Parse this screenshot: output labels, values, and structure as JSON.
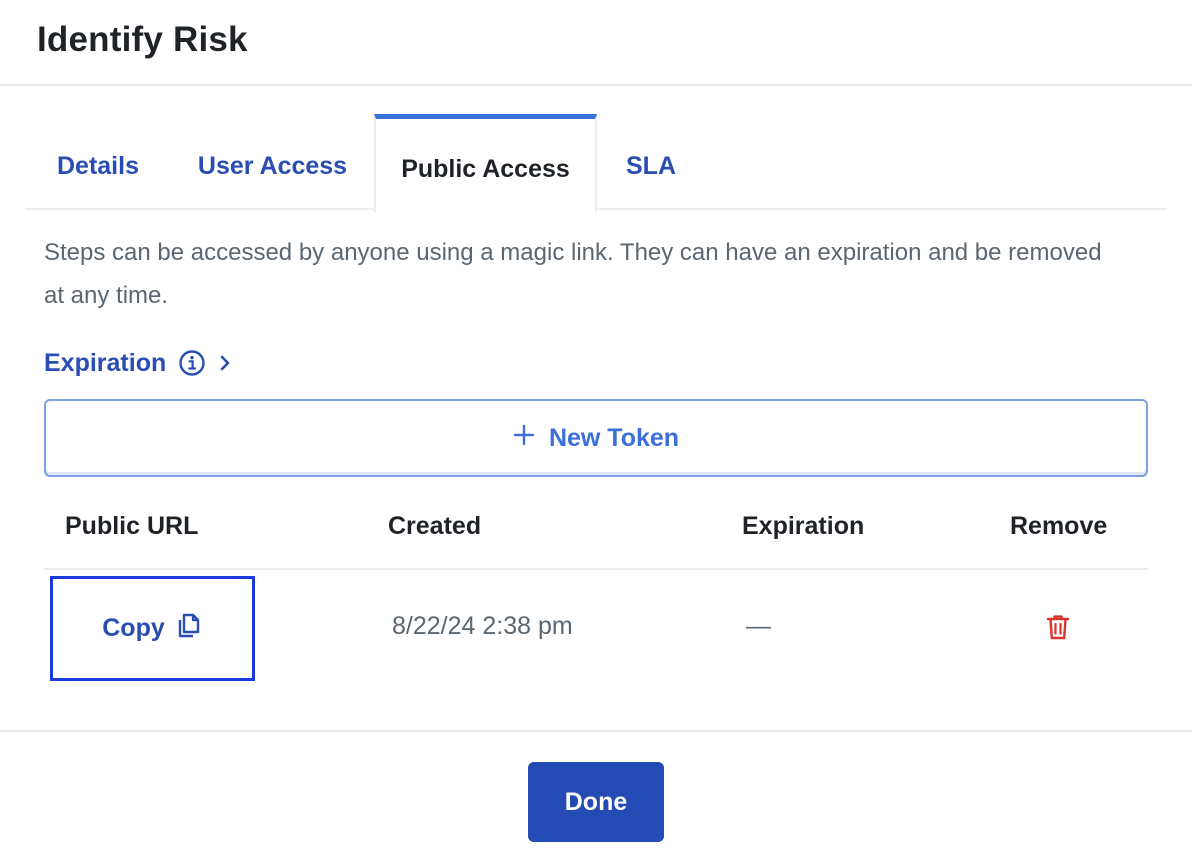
{
  "dialog": {
    "title": "Identify Risk"
  },
  "tabs": [
    {
      "label": "Details",
      "active": false
    },
    {
      "label": "User Access",
      "active": false
    },
    {
      "label": "Public Access",
      "active": true
    },
    {
      "label": "SLA",
      "active": false
    }
  ],
  "public_access": {
    "description": "Steps can be accessed by anyone using a magic link. They can have an expiration and be removed at any time.",
    "expiration_link": {
      "label": "Expiration",
      "icons": [
        "info-icon",
        "chevron-right-icon"
      ]
    },
    "new_token_label": "New Token",
    "table": {
      "columns": [
        "Public URL",
        "Created",
        "Expiration",
        "Remove"
      ],
      "rows": [
        {
          "public_url_action": "Copy",
          "created": "8/22/24 2:38 pm",
          "expiration": "—",
          "remove_icon": "trash-icon"
        }
      ]
    }
  },
  "footer": {
    "done_label": "Done"
  },
  "colors": {
    "accent": "#2a4db3",
    "button_primary": "#244bb4",
    "danger": "#d9342b",
    "focus_outline": "#1b3be0",
    "muted_text": "#5b6670"
  }
}
